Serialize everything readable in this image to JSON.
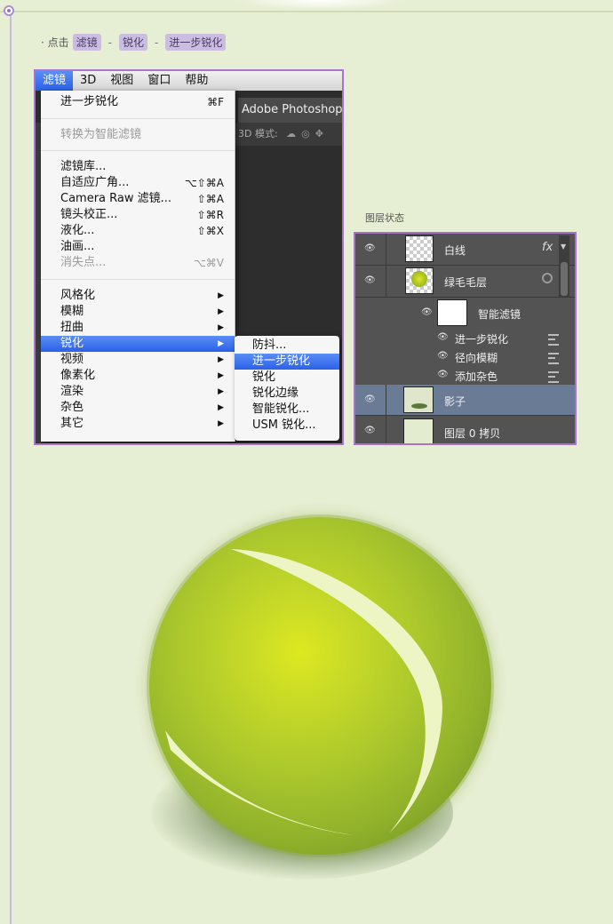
{
  "step": {
    "bullet": "· 点击",
    "path": [
      "滤镜",
      "锐化",
      "进一步锐化"
    ],
    "separator": "-"
  },
  "menubar": {
    "items": [
      "滤镜",
      "3D",
      "视图",
      "窗口",
      "帮助"
    ],
    "active": "滤镜"
  },
  "photoshop": {
    "title": "Adobe Photoshop",
    "toolbar_label": "3D 模式:"
  },
  "filter_menu": {
    "items": [
      {
        "label": "进一步锐化",
        "shortcut": "⌘F"
      },
      {
        "label": "转换为智能滤镜",
        "disabled": true
      },
      {
        "label": "滤镜库..."
      },
      {
        "label": "自适应广角...",
        "shortcut": "⌥⇧⌘A"
      },
      {
        "label": "Camera Raw 滤镜...",
        "shortcut": "⇧⌘A"
      },
      {
        "label": "镜头校正...",
        "shortcut": "⇧⌘R"
      },
      {
        "label": "液化...",
        "shortcut": "⇧⌘X"
      },
      {
        "label": "油画..."
      },
      {
        "label": "消失点...",
        "shortcut": "⌥⌘V",
        "disabled": true
      },
      {
        "label": "风格化",
        "submenu": true
      },
      {
        "label": "模糊",
        "submenu": true
      },
      {
        "label": "扭曲",
        "submenu": true
      },
      {
        "label": "锐化",
        "submenu": true,
        "highlighted": true
      },
      {
        "label": "视频",
        "submenu": true
      },
      {
        "label": "像素化",
        "submenu": true
      },
      {
        "label": "渲染",
        "submenu": true
      },
      {
        "label": "杂色",
        "submenu": true
      },
      {
        "label": "其它",
        "submenu": true
      }
    ],
    "arrow": "▶"
  },
  "sharpen_submenu": {
    "items": [
      {
        "label": "防抖..."
      },
      {
        "label": "进一步锐化",
        "highlighted": true
      },
      {
        "label": "锐化"
      },
      {
        "label": "锐化边缘"
      },
      {
        "label": "智能锐化..."
      },
      {
        "label": "USM 锐化..."
      }
    ]
  },
  "layers_panel": {
    "title": "图层状态",
    "layers": [
      {
        "name": "白线",
        "fx": "fx"
      },
      {
        "name": "绿毛毛层"
      },
      {
        "name": "智能滤镜"
      },
      {
        "name": "进一步锐化"
      },
      {
        "name": "径向模糊"
      },
      {
        "name": "添加杂色"
      },
      {
        "name": "影子",
        "selected": true
      },
      {
        "name": "图层 0 拷贝"
      }
    ],
    "eye_glyph": "👁"
  },
  "colors": {
    "background": "#e6eed3",
    "highlight": "#2a61e8",
    "border": "#a774c9",
    "ball": "#c6d928",
    "seam": "#eef5c4"
  }
}
